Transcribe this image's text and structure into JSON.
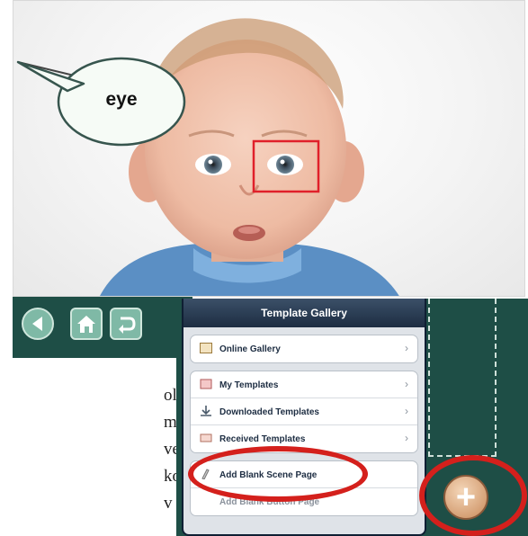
{
  "scene": {
    "speech_bubble_label": "eye"
  },
  "article": {
    "lines": [
      "olužáka.",
      "mého",
      "ve srovnání",
      "kou méně",
      "v stř"
    ]
  },
  "popover": {
    "title": "Template Gallery",
    "online_gallery": "Online Gallery",
    "my_templates": "My Templates",
    "downloaded_templates": "Downloaded Templates",
    "received_templates": "Received Templates",
    "add_blank_scene_page": "Add Blank Scene Page",
    "partial_row": "Add Blank Button Page",
    "chevron": "›"
  },
  "plus_button": {
    "label": "+"
  },
  "colors": {
    "panel_green": "#1e4e46",
    "highlight_red": "#d4201c",
    "nav_button": "#7fb9a6"
  },
  "icons": [
    "back-arrow-icon",
    "home-icon",
    "redo-icon",
    "gallery-icon",
    "templates-icon",
    "download-icon",
    "received-icon",
    "blank-page-icon",
    "plus-icon"
  ]
}
